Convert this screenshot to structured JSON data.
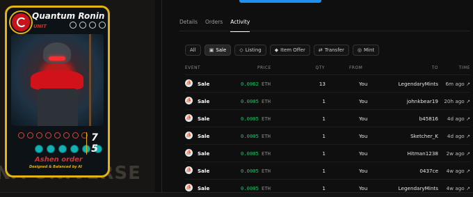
{
  "card": {
    "title": "Quantum Ronin",
    "unit": "UNIT",
    "stat_top": "7",
    "stat_bottom": "5",
    "order": "Ashen order",
    "designed": "Designed & Balanced by AI"
  },
  "background_text": "NA UNIVERSE",
  "tabs": [
    {
      "label": "Details"
    },
    {
      "label": "Orders"
    },
    {
      "label": "Activity",
      "active": true
    }
  ],
  "filters": [
    {
      "label": "All",
      "icon": ""
    },
    {
      "label": "Sale",
      "icon": "shopping-bag-icon",
      "active": true
    },
    {
      "label": "Listing",
      "icon": "tag-icon"
    },
    {
      "label": "Item Offer",
      "icon": "offer-icon"
    },
    {
      "label": "Transfer",
      "icon": "transfer-arrows-icon"
    },
    {
      "label": "Mint",
      "icon": "mint-icon"
    }
  ],
  "table": {
    "headers": {
      "event": "EVENT",
      "price": "PRICE",
      "qty": "QTY",
      "from": "FROM",
      "to": "TO",
      "time": "TIME"
    },
    "rows": [
      {
        "event": "Sale",
        "price": "0.0062",
        "currency": "ETH",
        "qty": "13",
        "from": "You",
        "to": "LegendaryMints",
        "time": "6m ago ↗"
      },
      {
        "event": "Sale",
        "price": "0.0005",
        "currency": "ETH",
        "qty": "1",
        "from": "You",
        "to": "johnkbear19",
        "time": "20h ago ↗"
      },
      {
        "event": "Sale",
        "price": "0.0005",
        "currency": "ETH",
        "qty": "1",
        "from": "You",
        "to": "b45816",
        "time": "4d ago ↗"
      },
      {
        "event": "Sale",
        "price": "0.0005",
        "currency": "ETH",
        "qty": "1",
        "from": "You",
        "to": "Sketcher_K",
        "time": "4d ago ↗"
      },
      {
        "event": "Sale",
        "price": "0.0005",
        "currency": "ETH",
        "qty": "1",
        "from": "You",
        "to": "Hitman1238",
        "time": "2w ago ↗"
      },
      {
        "event": "Sale",
        "price": "0.0005",
        "currency": "ETH",
        "qty": "1",
        "from": "You",
        "to": "0437ce",
        "time": "4w ago ↗"
      },
      {
        "event": "Sale",
        "price": "0.0005",
        "currency": "ETH",
        "qty": "1",
        "from": "You",
        "to": "LegendaryMints",
        "time": "4w ago ↗"
      }
    ]
  },
  "colors": {
    "accent": "#1f8ff0",
    "price_green": "#27c06a",
    "card_gold": "#e3b412",
    "card_red": "#c9131b"
  }
}
